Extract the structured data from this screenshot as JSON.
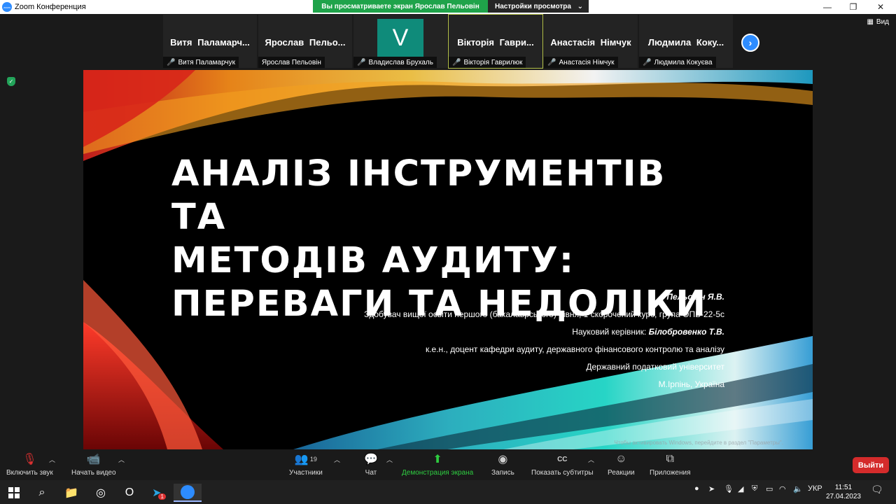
{
  "window": {
    "title": "Zoom Конференция",
    "minimize": "—",
    "maximize": "❐",
    "close": "✕"
  },
  "share_banner": {
    "viewing": "Вы просматриваете экран Ярослав Пельовін",
    "settings": "Настройки просмотра",
    "chevron": "⌄"
  },
  "participants_strip": [
    {
      "name": "Витя  Паламарч...",
      "label": "Витя Паламарчук",
      "muted": true
    },
    {
      "name": "Ярослав  Пельо...",
      "label": "Ярослав Пельовін",
      "muted": false
    },
    {
      "name": "",
      "avatar": "V",
      "label": "Владислав Брухаль",
      "muted": true
    },
    {
      "name": "Вікторія  Гаври...",
      "label": "Вікторія Гаврилюк",
      "muted": true,
      "active": true
    },
    {
      "name": "Анастасія  Німчук",
      "label": "Анастасія Німчук",
      "muted": true
    },
    {
      "name": "Людмила  Коку...",
      "label": "Людмила Кокуєва",
      "muted": true
    }
  ],
  "view_button": "Вид",
  "slide": {
    "title_lines": [
      "АНАЛІЗ ІНСТРУМЕНТІВ ТА",
      "МЕТОДІВ АУДИТУ:",
      "ПЕРЕВАГИ ТА НЕДОЛІКИ"
    ],
    "author": "Пельовін Я.В.",
    "line1": "Здобувач вищої освіти першого (бакалаврського) рівня, 1 скорочений курс, група ОПБ-22-5с",
    "line2_prefix": "Науковий керівник: ",
    "line2_name": "Білобровенко Т.В.",
    "line3": "к.е.н., доцент кафедри аудиту, державного фінансового контролю та аналізу",
    "line4": "Державний податковий університет",
    "line5": "М.Ірпінь, Україна",
    "watermark": "Чтобы активировать Windows, перейдите в раздел \"Параметры\"."
  },
  "toolbar": {
    "audio": "Включить звук",
    "video": "Начать видео",
    "participants": "Участники",
    "participants_count": "19",
    "chat": "Чат",
    "share": "Демонстрация экрана",
    "record": "Запись",
    "captions": "Показать субтитры",
    "captions_icon": "CC",
    "reactions": "Реакции",
    "apps": "Приложения",
    "exit": "Выйти"
  },
  "taskbar": {
    "language": "УКР",
    "time": "11:51",
    "date": "27.04.2023",
    "telegram_badge": "1"
  },
  "colors": {
    "zoom_blue": "#2d8cff",
    "share_green": "#1fa34a",
    "exit_red": "#d42b2b",
    "muted_red": "#e03131"
  }
}
